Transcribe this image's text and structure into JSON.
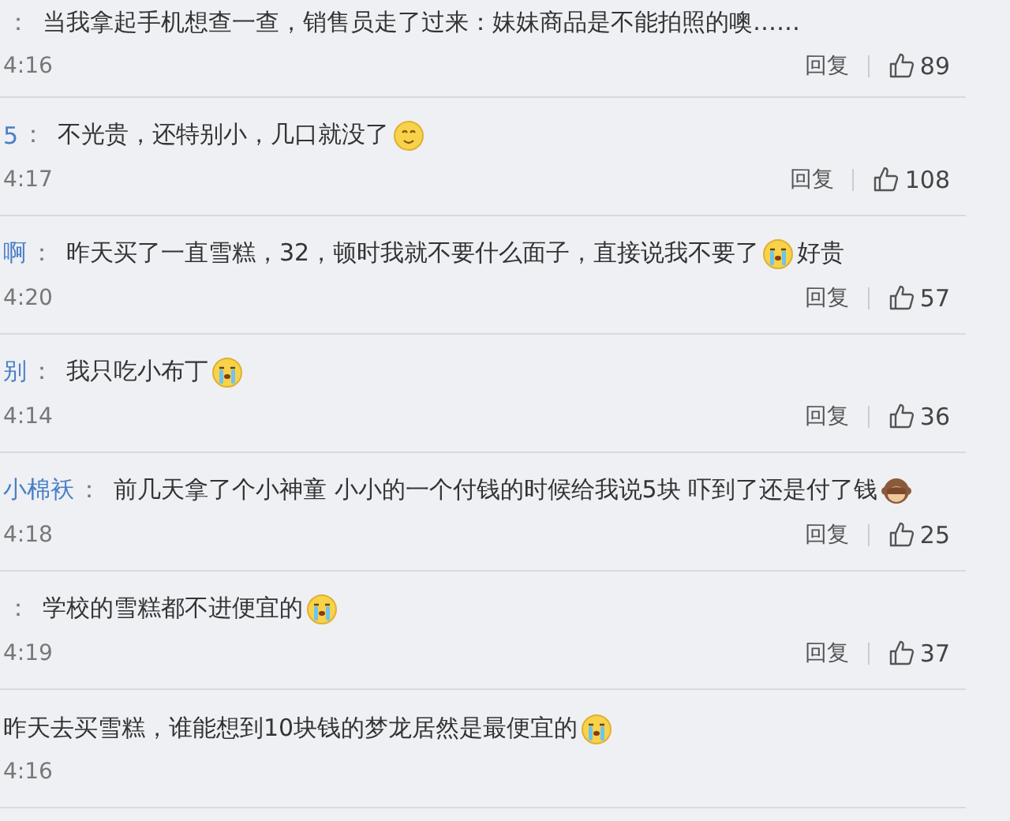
{
  "comments": [
    {
      "separator": "：",
      "parts": [
        {
          "kind": "text",
          "text": "当我拿起手机想查一查，销售员走了过来：妹妹商品是不能拍照的噢……"
        }
      ],
      "time": "4:16",
      "reply": "回复",
      "likes": "89"
    },
    {
      "user": "5",
      "separator": "：",
      "parts": [
        {
          "kind": "text",
          "text": "不光贵，还特别小，几口就没了"
        },
        {
          "kind": "smile"
        }
      ],
      "time": "4:17",
      "reply": "回复",
      "likes": "108"
    },
    {
      "user": "啊",
      "separator": "：",
      "parts": [
        {
          "kind": "text",
          "text": "昨天买了一直雪糕，32，顿时我就不要什么面子，直接说我不要了"
        },
        {
          "kind": "cry"
        },
        {
          "kind": "text",
          "text": "好贵"
        }
      ],
      "time": "4:20",
      "reply": "回复",
      "likes": "57"
    },
    {
      "user": "别",
      "separator": "：",
      "parts": [
        {
          "kind": "text",
          "text": "我只吃小布丁"
        },
        {
          "kind": "cry"
        }
      ],
      "time": "4:14",
      "reply": "回复",
      "likes": "36"
    },
    {
      "user": "小棉袄",
      "separator": "：",
      "parts": [
        {
          "kind": "text",
          "text": "前几天拿了个小神童 小小的一个付钱的时候给我说5块 吓到了还是付了钱"
        },
        {
          "kind": "monkey"
        }
      ],
      "time": "4:18",
      "reply": "回复",
      "likes": "25"
    },
    {
      "separator": "：",
      "parts": [
        {
          "kind": "text",
          "text": "学校的雪糕都不进便宜的"
        },
        {
          "kind": "cry"
        }
      ],
      "time": "4:19",
      "reply": "回复",
      "likes": "37"
    },
    {
      "parts": [
        {
          "kind": "text",
          "text": "昨天去买雪糕，谁能想到10块钱的梦龙居然是最便宜的"
        },
        {
          "kind": "cry"
        }
      ],
      "time": "4:16"
    }
  ]
}
